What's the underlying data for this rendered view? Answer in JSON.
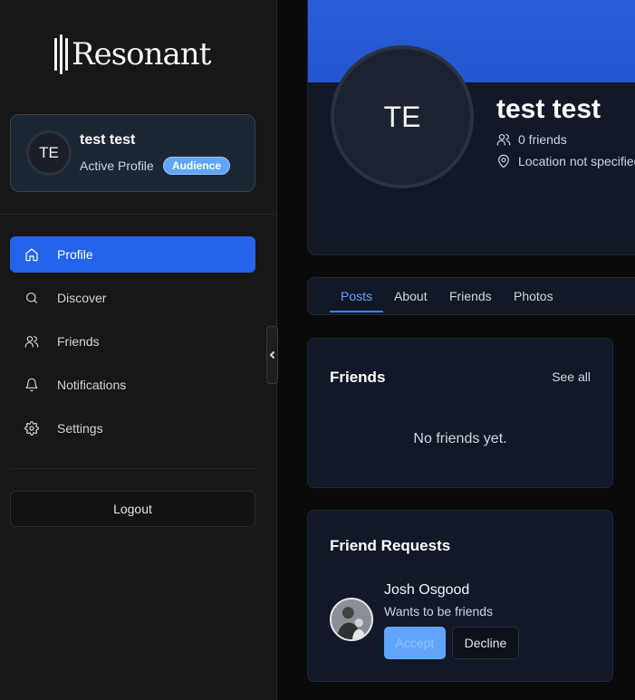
{
  "app": {
    "name": "Resonant"
  },
  "profile_card": {
    "initials": "TE",
    "name": "test test",
    "status": "Active Profile",
    "badge": "Audience"
  },
  "nav": {
    "items": [
      {
        "label": "Profile",
        "icon": "home-icon",
        "active": true
      },
      {
        "label": "Discover",
        "icon": "search-icon",
        "active": false
      },
      {
        "label": "Friends",
        "icon": "users-icon",
        "active": false
      },
      {
        "label": "Notifications",
        "icon": "bell-icon",
        "active": false
      },
      {
        "label": "Settings",
        "icon": "gear-icon",
        "active": false
      }
    ],
    "logout_label": "Logout"
  },
  "header": {
    "initials": "TE",
    "name": "test test",
    "friends_count": "0 friends",
    "location": "Location not specified"
  },
  "tabs": [
    {
      "label": "Posts",
      "active": true
    },
    {
      "label": "About",
      "active": false
    },
    {
      "label": "Friends",
      "active": false
    },
    {
      "label": "Photos",
      "active": false
    }
  ],
  "friends_card": {
    "title": "Friends",
    "see_all": "See all",
    "empty": "No friends yet."
  },
  "requests_card": {
    "title": "Friend Requests",
    "requests": [
      {
        "name": "Josh Osgood",
        "message": "Wants to be friends",
        "accept": "Accept",
        "decline": "Decline"
      }
    ]
  },
  "colors": {
    "accent": "#2563eb",
    "badge": "#60a5fa",
    "banner": "#2a5fd8"
  }
}
